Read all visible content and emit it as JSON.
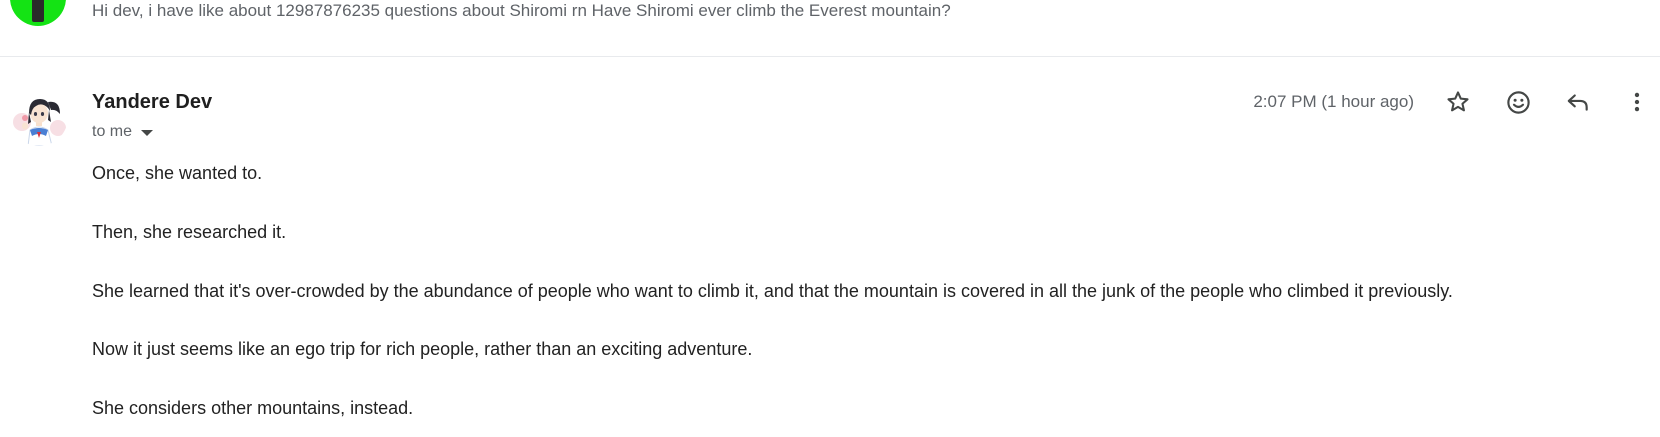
{
  "previous_message": {
    "snippet": "Hi dev, i have like about 12987876235 questions about Shiromi rn Have Shiromi ever climb the Everest mountain?",
    "avatar_color": "#14e314"
  },
  "message": {
    "sender": "Yandere Dev",
    "recipient_label": "to me",
    "timestamp": "2:07 PM (1 hour ago)",
    "actions": {
      "star_icon": "star-outline-icon",
      "emoji_icon": "emoji-react-icon",
      "reply_icon": "reply-icon",
      "more_icon": "more-vert-icon"
    },
    "body": [
      "Once, she wanted to.",
      "Then, she researched it.",
      "She learned that it's over-crowded by the abundance of people who want to climb it, and that the mountain is covered in all the junk of the people who climbed it previously.",
      "Now it just seems like an ego trip for rich people, rather than an exciting adventure.",
      "She considers other mountains, instead."
    ]
  },
  "colors": {
    "icon": "#444746",
    "secondary_text": "#5f6368",
    "body_text": "#222222",
    "divider": "#e8eaed"
  }
}
